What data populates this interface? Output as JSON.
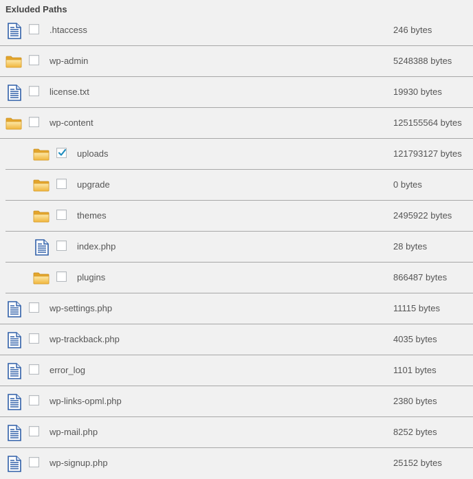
{
  "heading": "Exluded Paths",
  "items": [
    {
      "name": ".htaccess",
      "size": "246 bytes",
      "icon": "file-icon",
      "checked": false,
      "level": 0
    },
    {
      "name": "wp-admin",
      "size": "5248388 bytes",
      "icon": "folder-icon",
      "checked": false,
      "level": 0
    },
    {
      "name": "license.txt",
      "size": "19930 bytes",
      "icon": "file-icon",
      "checked": false,
      "level": 0
    },
    {
      "name": "wp-content",
      "size": "125155564 bytes",
      "icon": "folder-icon",
      "checked": false,
      "level": 0
    },
    {
      "name": "uploads",
      "size": "121793127 bytes",
      "icon": "folder-icon",
      "checked": true,
      "level": 1
    },
    {
      "name": "upgrade",
      "size": "0 bytes",
      "icon": "folder-icon",
      "checked": false,
      "level": 1
    },
    {
      "name": "themes",
      "size": "2495922 bytes",
      "icon": "folder-icon",
      "checked": false,
      "level": 1
    },
    {
      "name": "index.php",
      "size": "28 bytes",
      "icon": "file-icon",
      "checked": false,
      "level": 1
    },
    {
      "name": "plugins",
      "size": "866487 bytes",
      "icon": "folder-icon",
      "checked": false,
      "level": 1
    },
    {
      "name": "wp-settings.php",
      "size": "11115 bytes",
      "icon": "file-icon",
      "checked": false,
      "level": 0
    },
    {
      "name": "wp-trackback.php",
      "size": "4035 bytes",
      "icon": "file-icon",
      "checked": false,
      "level": 0
    },
    {
      "name": "error_log",
      "size": "1101 bytes",
      "icon": "file-icon",
      "checked": false,
      "level": 0
    },
    {
      "name": "wp-links-opml.php",
      "size": "2380 bytes",
      "icon": "file-icon",
      "checked": false,
      "level": 0
    },
    {
      "name": "wp-mail.php",
      "size": "8252 bytes",
      "icon": "file-icon",
      "checked": false,
      "level": 0
    },
    {
      "name": "wp-signup.php",
      "size": "25152 bytes",
      "icon": "file-icon",
      "checked": false,
      "level": 0
    }
  ],
  "colors": {
    "background": "#f1f1f1",
    "divider": "#a7a7a7",
    "text": "#555555",
    "checkmark": "#1e8cbe",
    "folder": "#f0b840",
    "file": "#2f5fa8"
  }
}
